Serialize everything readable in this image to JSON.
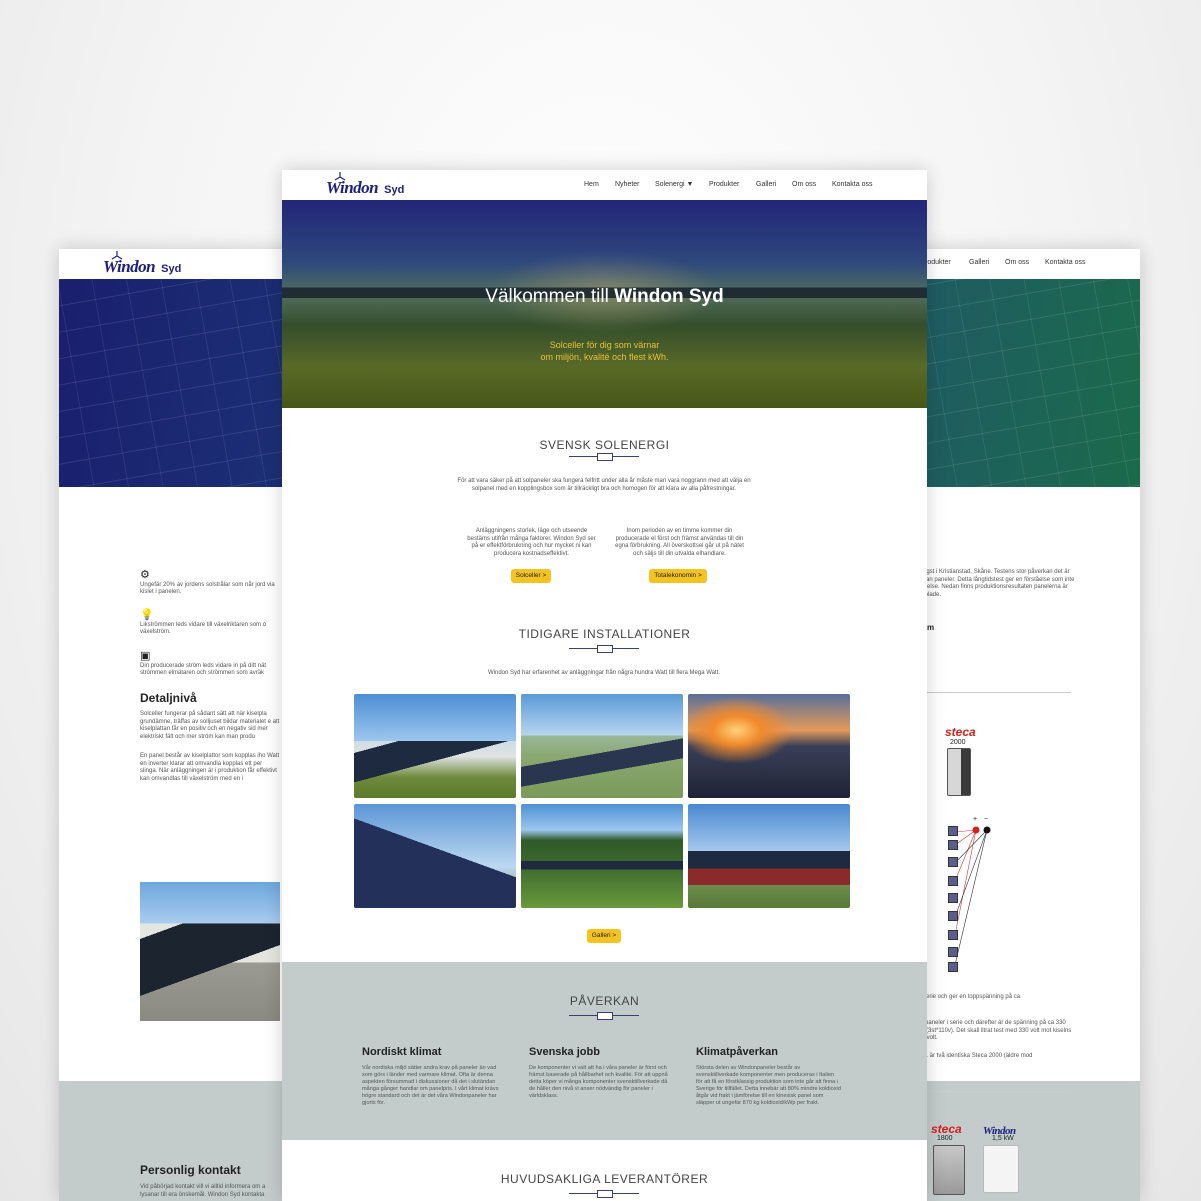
{
  "brand": {
    "name": "Windon",
    "suffix": "Syd",
    "color": "#1d2080",
    "accent": "#f3c322"
  },
  "nav": {
    "items": [
      "Hem",
      "Nyheter",
      "Solenergi ▼",
      "Produkter",
      "Galleri",
      "Om oss",
      "Kontakta oss"
    ]
  },
  "hero": {
    "title_prefix": "Välkommen till",
    "title_bold": "Windon Syd",
    "subtitle_1": "Solceller för dig som värnar",
    "subtitle_2": "om miljön, kvalité och flest kWh."
  },
  "svensk": {
    "title": "SVENSK SOLENERGI",
    "intro": "För att vara säker på att solpaneler ska fungera felfritt under alla år måste man vara noggrann med att välja en solpanel med en kopplingsbox som är tillräckligt bra och homogen för att klara av alla påfrestningar.",
    "left_text": "Anläggningens storlek, läge och utseende bestäms utifrån många faktorer. Windon Syd ser på er effektförbrukning och hur mycket ni kan producera kostnadseffektivt.",
    "right_text": "Inom perioden av en timme kommer din producerade el först och främst användas till din egna förbrukning. All överskottsel går ut på nätet och säljs till din utvalda elhandlare.",
    "btn_left": "Solceller >",
    "btn_right": "Totalekonomin >"
  },
  "installs": {
    "title": "TIDIGARE INSTALLATIONER",
    "intro": "Windon Syd har erfarenhet av anläggningar från några hundra Watt till flera Mega Watt.",
    "btn": "Galleri >"
  },
  "paverkan": {
    "title": "PÅVERKAN",
    "cols": [
      {
        "head": "Nordiskt klimat",
        "text": "Vår nordiska miljö sätter andra krav på paneler än vad som görs i länder med varmare klimat. Ofta är denna aspekten försummad i diskussioner då det i slutändan många gånger handlar om panelpris. I vårt klimat krävs högre standard och det är det våra Windonpaneler har gjorts för."
      },
      {
        "head": "Svenska jobb",
        "text": "De komponenter vi valt att ha i våra paneler är först och främst baserade på hållbarhet och kvalité. För att uppnå detta köper vi många komponenter svensktillverkade då de håller den nivå vi anser nödvändig för paneler i världsklass."
      },
      {
        "head": "Klimatpåverkan",
        "text": "Största delen av Windonpaneler består av svensktillverkade komponenter men produceras i Italien för att få en förstklassig produktion som inte går att finna i Sverige för tillfället. Detta innebär att 80% mindre koldioxid åtgår vid frakt i jämförelse till en kinesisk panel som släpper ut ungefär 870 kg koldioxid/kWp per frakt."
      }
    ]
  },
  "leverantorer": {
    "title": "HUVUDSAKLIGA LEVERANTÖRER"
  },
  "left_page": {
    "items": [
      {
        "icon": "gear-icon",
        "text": "Ungefär 20% av jordens solstrålar som når jord via kislet i panelen."
      },
      {
        "icon": "bulb-icon",
        "text": "Likströmmen leds vidare till växelriktaren som o växelström."
      },
      {
        "icon": "money-icon",
        "text": "Din producerade ström leds vidare in på ditt nät strömmen elmätaren och strömmen som avräk"
      }
    ],
    "detail_head": "Detaljnivå",
    "detail_text_1": "Solceller fungerar på sådant sätt att när kiselpla grundämne, träffas av solljuset bildar materialet e att kiselplattan får en positiv och en negativ sid mer elektriskt fält och mer ström kan man produ",
    "detail_text_2": "En panel består av kiselplattor som kopplas iho Watt en inverter klarar att omvandla kopplas ett per slinga. När anläggningen är i produktion får effektivt kan omvandlas till växelström med en i",
    "contact_head": "Personlig kontakt",
    "contact_text": "Vid påbörjad kontakt vill vi alltid informera om a lysanar till era önskemål. Windon Syd kontakta"
  },
  "right_page": {
    "nav": [
      "rodukter",
      "Galleri",
      "Om oss",
      "Kontakta oss"
    ],
    "text_1": "eläggst i Kristianstad, Skåne. Testens stor påverkan det är mellan paneler. Detta långtidstest ger en förståelse som inte mförelse. Nedan finns produktionsresultaten panelerna är kopplade.",
    "film": "nfilm",
    "steca_1": "steca",
    "steca_1_model": "2000",
    "text_2": "e i serie och ger en toppspänning på ca",
    "text_3": "e 3 paneler i serie och därefter är de spänning på ca 330 volt (3st*110v). Det skall lltrat test med 330 volt mot kiselns 234 volt.",
    "text_4": "est 1 är två identiska Steca 2000 (äldre mod",
    "steca_2": "steca",
    "steca_2_model": "1800",
    "windon_model": "1,5 kW",
    "plus": "+",
    "minus": "−"
  }
}
